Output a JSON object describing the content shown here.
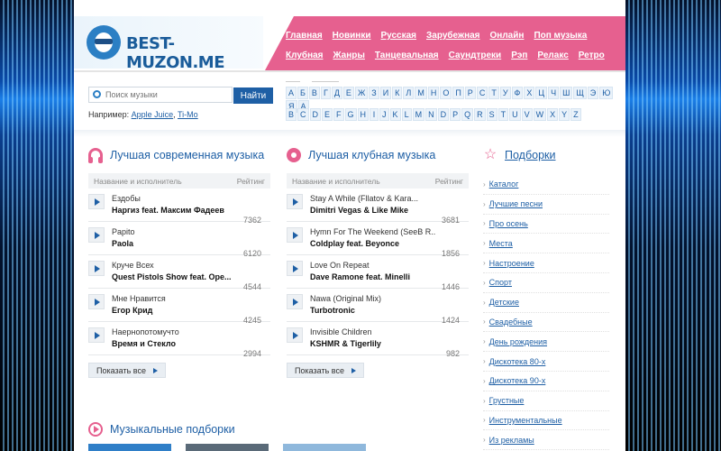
{
  "site": {
    "logo_text": "BEST-MUZON.ME"
  },
  "nav": {
    "row1": [
      "Главная",
      "Новинки",
      "Русская",
      "Зарубежная",
      "Онлайн",
      "Поп музыка"
    ],
    "row2": [
      "Клубная",
      "Жанры",
      "Танцевальная",
      "Саундтреки",
      "Рэп",
      "Релакс",
      "Ретро"
    ]
  },
  "search": {
    "placeholder": "Поиск музыки",
    "value": "Поиск музыки",
    "button": "Найти",
    "example_label": "Например:",
    "example_links": [
      "Apple Juice",
      "Ti-Mo"
    ]
  },
  "alphabet": {
    "ru": [
      "А",
      "Б",
      "В",
      "Г",
      "Д",
      "Е",
      "Ж",
      "З",
      "И",
      "К",
      "Л",
      "М",
      "Н",
      "О",
      "П",
      "Р",
      "С",
      "Т",
      "У",
      "Ф",
      "Х",
      "Ц",
      "Ч",
      "Ш",
      "Щ",
      "Э",
      "Ю",
      "Я",
      "A"
    ],
    "en": [
      "B",
      "C",
      "D",
      "E",
      "F",
      "G",
      "H",
      "I",
      "J",
      "K",
      "L",
      "M",
      "N",
      "D",
      "P",
      "Q",
      "R",
      "S",
      "T",
      "U",
      "V",
      "W",
      "X",
      "Y",
      "Z"
    ]
  },
  "modern": {
    "title": "Лучшая современная музыка",
    "col_name": "Название и исполнитель",
    "col_rating": "Рейтинг",
    "tracks": [
      {
        "song": "Ездобы",
        "artist": "Наргиз feat. Максим Фадеев",
        "rating": "7362"
      },
      {
        "song": "Papito",
        "artist": "Paola",
        "rating": "6120"
      },
      {
        "song": "Круче Всех",
        "artist": "Quest Pistols Show feat. Ope...",
        "rating": "4544"
      },
      {
        "song": "Мне Нравится",
        "artist": "Егор Крид",
        "rating": "4245"
      },
      {
        "song": "Наернопотомучто",
        "artist": "Время и Стекло",
        "rating": "2994"
      }
    ],
    "show_all": "Показать все"
  },
  "club": {
    "title": "Лучшая клубная музыка",
    "col_name": "Название и исполнитель",
    "col_rating": "Рейтинг",
    "tracks": [
      {
        "song": "Stay A While (Fllatov & Kara...",
        "artist": "Dimitri Vegas & Like Mike",
        "rating": "3681"
      },
      {
        "song": "Hymn For The Weekend (SeeB R...",
        "artist": "Coldplay feat. Beyonce",
        "rating": "1856"
      },
      {
        "song": "Love On Repeat",
        "artist": "Dave Ramone feat. Minelli",
        "rating": "1446"
      },
      {
        "song": "Nawa (Original Mix)",
        "artist": "Turbotronic",
        "rating": "1424"
      },
      {
        "song": "Invisible Children",
        "artist": "KSHMR & Tigerlily",
        "rating": "982"
      }
    ],
    "show_all": "Показать все"
  },
  "collections": {
    "title": "Подборки",
    "items": [
      "Каталог",
      "Лучшие песни",
      "Про осень",
      "Места",
      "Настроение",
      "Спорт",
      "Детские",
      "Свадебные",
      "День рождения",
      "Дискотека 80-х",
      "Дискотека 90-х",
      "Грустные",
      "Инструментальные",
      "Из рекламы"
    ]
  },
  "music_collections": {
    "title": "Музыкальные подборки"
  },
  "colors": {
    "accent_pink": "#e6608f",
    "link_blue": "#1e5fa5",
    "logo_blue": "#2b7fc4"
  }
}
